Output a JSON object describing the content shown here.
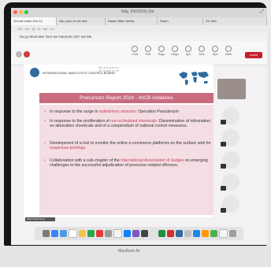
{
  "window": {
    "title": "Italy, (NUODS) (hn",
    "traffic_light_colors": [
      "#ff5f57",
      "#febc2e",
      "#28c840"
    ]
  },
  "tabs": [
    {
      "label": "Gra ad boam sho Cs"
    },
    {
      "label": "Gpu pow cd we ana"
    },
    {
      "label": "Nasan Mae mentip"
    },
    {
      "label": "Suprn"
    },
    {
      "label": "Sin Wsr"
    }
  ],
  "notice": {
    "text": "Ita go Moonsee 'Sen we Naunnes ist'n sat Me"
  },
  "toolbar": {
    "text": "Gw   ·   me   ·   (i)   ·  ro   ·   bar   ·   cu"
  },
  "meeting": {
    "controls": [
      "Chat",
      "Pole",
      "Rags",
      "Reign",
      "Aps",
      "Sare",
      "Apcl",
      "Mare"
    ],
    "leave_label": "Leare",
    "accent": "#c81e2b"
  },
  "slide": {
    "org_name": "INTERNATIONAL NARCOTICS CONTROL BOARD",
    "overlay_lines": [
      "Rin aUr pt.Ie om,",
      "Ne as ape yo. fd"
    ],
    "title": "Precursors Report 2024 - INCB initiatives",
    "title_band_color": "#c96d7e",
    "panel_color": "#f4dde3",
    "bullets": [
      {
        "pre": "In response to the surge in ",
        "hl": "ephedrines seizures",
        "post": ": Operation Pseudonym"
      },
      {
        "pre": "In response to the proliferation of ",
        "hl": "non-scheduled chemicals",
        "post": ": Dissemination of information on alternative chemicals and of a compendium of national control measures."
      },
      {
        "pre": "Development of a tool to monitor the online e-commerce platforms on the surface web for ",
        "hl": "suspicious postings",
        "post": "."
      },
      {
        "pre": "Collaboration with a sub-chapter of the ",
        "hl": "International Association of Judges",
        "post": " on emerging challenges to the successful adjudication of precursor-related offences."
      }
    ]
  },
  "status": {
    "user_label": "Jaya Vereamong"
  },
  "participants": {
    "count": 8
  },
  "dock": {
    "icon_colors": [
      "#7a7a7a",
      "#3b82f6",
      "#4a9be0",
      "#ffffff",
      "#f2c14e",
      "#2aa845",
      "#e53935",
      "#999999",
      "#f4f4f4",
      "#0a84ff",
      "#7e57c2",
      "#444444",
      "#e0e0e0",
      "#1f8f3a",
      "#d32f2f",
      "#2f6b9e",
      "#c0c0c0",
      "#1e88e5",
      "#ff9800",
      "#4caf50",
      "#f5f5f5",
      "#9e9e9e"
    ]
  },
  "brand": {
    "text": "MacBook Air"
  }
}
